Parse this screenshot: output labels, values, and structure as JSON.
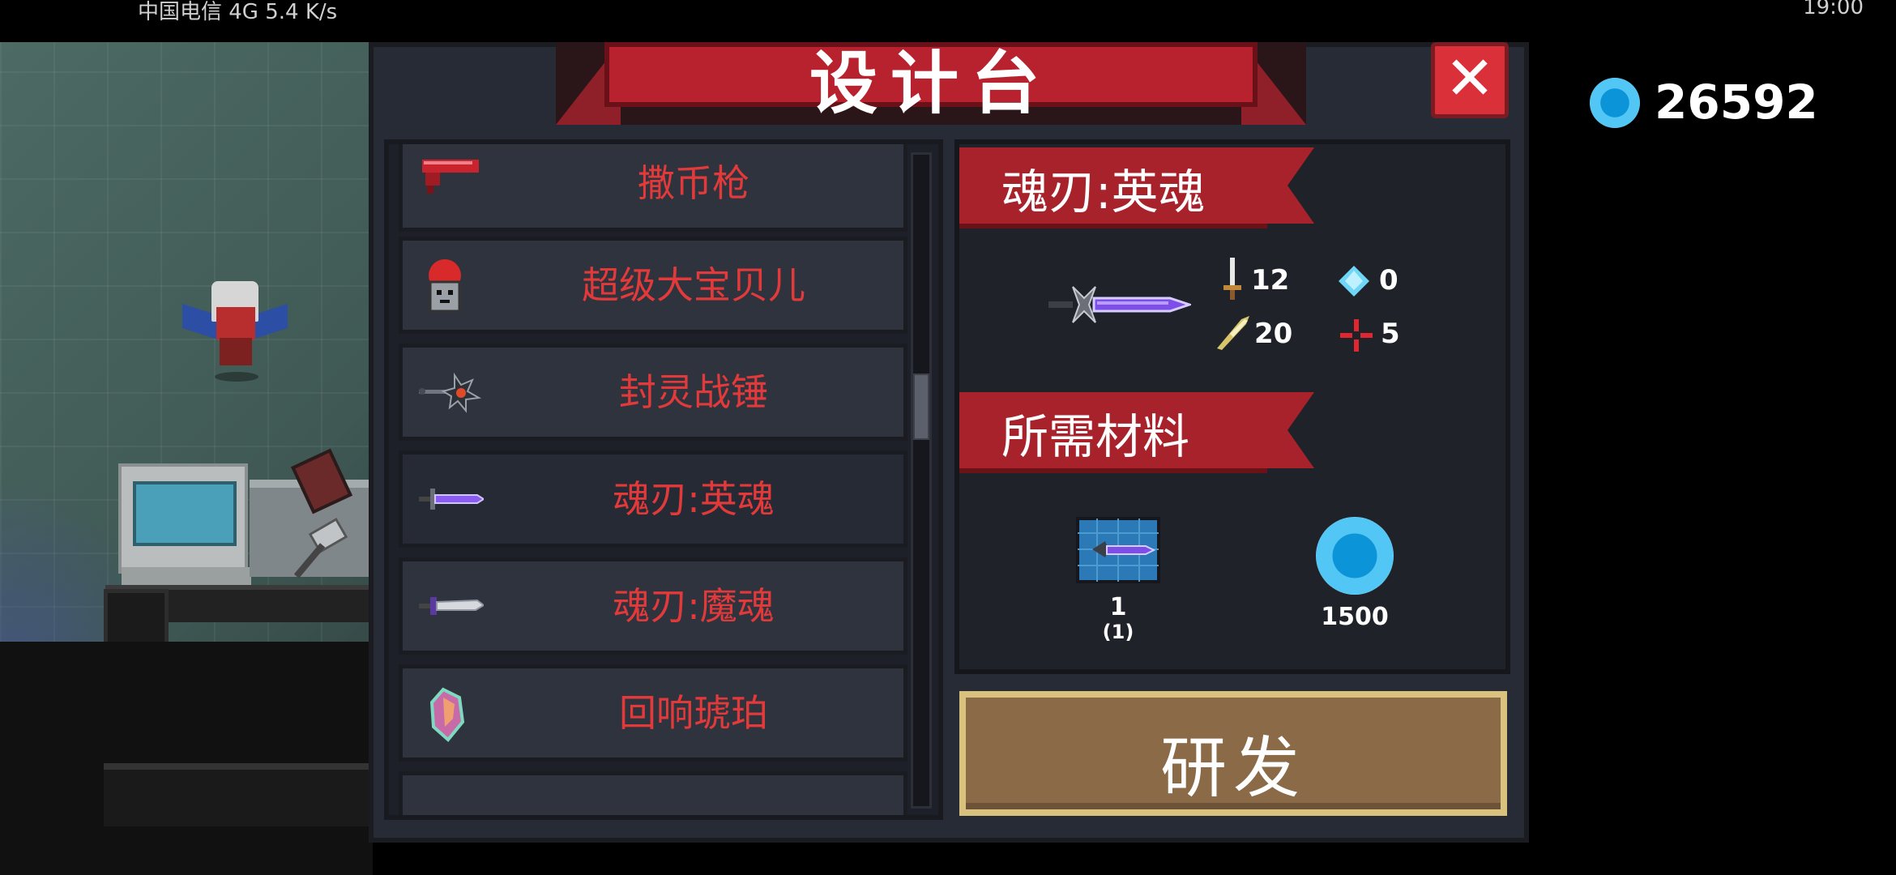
{
  "statusbar": {
    "left_text": "中国电信 4G 5.4 K/s",
    "right_text": "19:00"
  },
  "dialog": {
    "title": "设计台",
    "close_icon": "close-icon"
  },
  "weapon_list": [
    {
      "label": "撒币枪",
      "icon": "gun-icon"
    },
    {
      "label": "超级大宝贝儿",
      "icon": "mask-icon"
    },
    {
      "label": "封灵战锤",
      "icon": "warhammer-icon"
    },
    {
      "label": "魂刃:英魂",
      "icon": "purple-sword-icon",
      "selected": true
    },
    {
      "label": "魂刃:魔魂",
      "icon": "dark-sword-icon"
    },
    {
      "label": "回响琥珀",
      "icon": "amber-icon"
    },
    {
      "label": "...",
      "icon": "relic-icon"
    }
  ],
  "detail": {
    "weapon_name": "魂刃:英魂",
    "stats": {
      "damage": "12",
      "energy": "0",
      "crit": "20",
      "accuracy": "5"
    },
    "materials_title": "所需材料",
    "materials": [
      {
        "name": "blueprint",
        "count_top": "1",
        "count_bottom": "(1)"
      },
      {
        "name": "gem",
        "count_top": "1500"
      }
    ]
  },
  "develop_button": "研发",
  "currency": {
    "value": "26592",
    "icon": "gem-icon",
    "color": "#2fa9e8"
  },
  "colors": {
    "title_red": "#b8222e",
    "list_text_red": "#e23a3a",
    "button_brown": "#8a6a47"
  }
}
